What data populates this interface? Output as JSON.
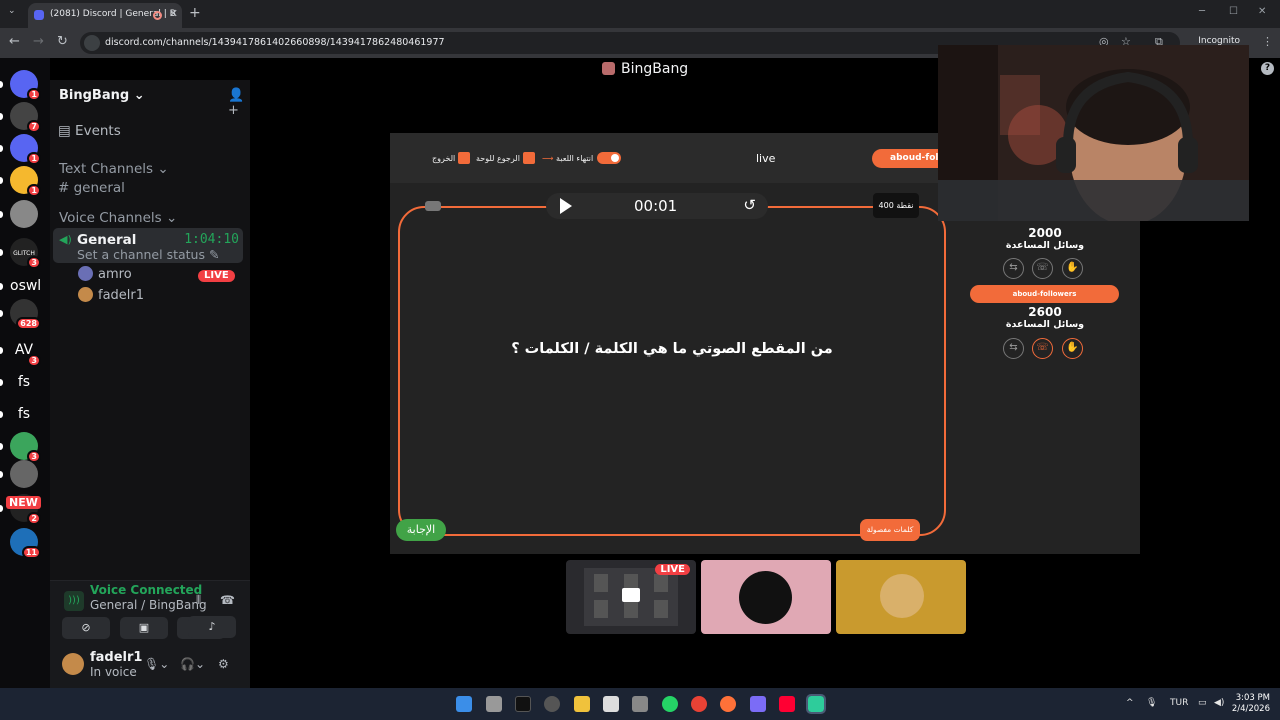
{
  "browser": {
    "tab_title": "(2081) Discord | General | B",
    "url": "discord.com/channels/1439417861402660898/1439417862480461977",
    "incognito_label": "Incognito"
  },
  "guilds": [
    {
      "label": "",
      "badge": "1",
      "color": "#5865f2",
      "kind": "discord"
    },
    {
      "label": "",
      "badge": "7",
      "color": "#444"
    },
    {
      "label": "",
      "badge": "1",
      "color": "#5865f2"
    },
    {
      "label": "",
      "badge": "1",
      "color": "#f5b82e"
    },
    {
      "label": "",
      "badge": "",
      "color": "#888"
    },
    {
      "label": "GLITCH",
      "badge": "3",
      "color": "#222"
    },
    {
      "label": "oswl",
      "badge": "",
      "color": "transparent"
    },
    {
      "label": "",
      "badge": "628",
      "color": "#333"
    },
    {
      "label": "AV",
      "badge": "3",
      "color": "transparent"
    },
    {
      "label": "fs",
      "badge": "",
      "color": "transparent"
    },
    {
      "label": "fs",
      "badge": "",
      "color": "transparent"
    },
    {
      "label": "",
      "badge": "3",
      "color": "#3ba55c"
    },
    {
      "label": "",
      "badge": "",
      "color": "#666"
    },
    {
      "label": "",
      "badge": "2",
      "color": "#222"
    },
    {
      "label": "",
      "badge": "11",
      "color": "#1e6fb8"
    }
  ],
  "new_tag": "NEW",
  "sidebar": {
    "server_name": "BingBang",
    "events_label": "Events",
    "text_channels_header": "Text Channels",
    "text_channel": "general",
    "voice_channels_header": "Voice Channels",
    "voice_channel": "General",
    "voice_timer": "1:04:10",
    "channel_status": "Set a channel status",
    "members": [
      "amro",
      "fadelr1"
    ],
    "live_badge": "LIVE"
  },
  "voice_panel": {
    "status": "Voice Connected",
    "location": "General / BingBang",
    "username": "fadelr1",
    "user_status": "In voice"
  },
  "stage": {
    "title": "BingBang"
  },
  "game": {
    "exit_label": "الخروج",
    "back_label": "الرجوع للوحة",
    "end_game_label": "انتهاء اللعبة",
    "live_label": "live",
    "username": "aboud-followers",
    "timer": "00:01",
    "points": "400 نقطة",
    "question": "من المقطع الصوتي ما هي الكلمة / الكلمات ؟",
    "answer_button": "الإجابة",
    "hidden_words_button": "كلمات مفصولة",
    "team1_score": "2000",
    "team2_name": "aboud-followers",
    "team2_score": "2600",
    "help_tools_label": "وسائل المساعدة"
  },
  "thumbnails": {
    "live_badge": "LIVE"
  },
  "taskbar": {
    "lang": "TUR",
    "time": "3:03 PM",
    "date": "2/4/2026"
  }
}
